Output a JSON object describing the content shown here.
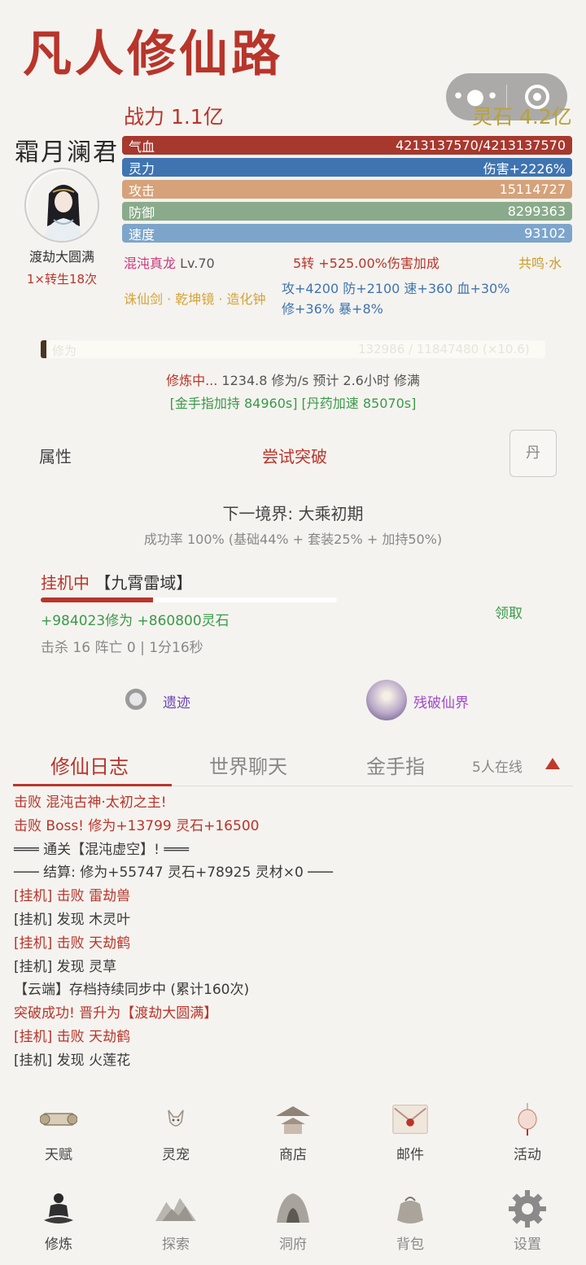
{
  "title": "凡人修仙路",
  "header": {
    "power": "战力 1.1亿",
    "spirit_stones": "灵石 4.2亿"
  },
  "player": {
    "name": "霜月澜君",
    "realm": "渡劫大圆满",
    "rebirth": "1×转生18次"
  },
  "stats": {
    "hp_label": "气血",
    "hp_value": "4213137570/4213137570",
    "mp_label": "灵力",
    "mp_value": "伤害+2226%",
    "atk_label": "攻击",
    "atk_value": "15114727",
    "def_label": "防御",
    "def_value": "8299363",
    "spd_label": "速度",
    "spd_value": "93102"
  },
  "pet": {
    "name": "混沌真龙",
    "level": "Lv.70",
    "rebirth_bonus": "5转 +525.00%伤害加成",
    "resonance": "共鸣·水"
  },
  "equipment": {
    "set": "诛仙剑 · 乾坤镜 · 造化钟",
    "bonus_line1": "攻+4200 防+2100 速+360 血+30%",
    "bonus_line2": "修+36% 暴+8%"
  },
  "cultivation": {
    "bar_label": "修为",
    "bar_value": "132986 / 11847480 (×10.6)",
    "progress": 0.011,
    "status": "修炼中...",
    "rate": " 1234.8 修为/s  预计 2.6小时 修满",
    "buffs": "[金手指加持 84960s] [丹药加速 85070s]"
  },
  "actions": {
    "attributes": "属性",
    "breakthrough": "尝试突破",
    "pill": "丹"
  },
  "breakthrough": {
    "next_realm": "下一境界: 大乘初期",
    "success_rate": "成功率 100% (基础44% + 套装25% + 加持50%)"
  },
  "afk": {
    "status": "挂机中",
    "location": " 【九霄雷域】",
    "progress": 0.38,
    "gains": "+984023修为  +860800灵石",
    "claim": "领取",
    "stats": "击杀 16  阵亡 0  |  1分16秒"
  },
  "portals": {
    "ruins": "遗迹",
    "broken_realm": "残破仙界"
  },
  "tabs": {
    "log": "修仙日志",
    "chat": "世界聊天",
    "cheat": "金手指",
    "online": "5人在线"
  },
  "log": [
    {
      "text": "击败 混沌古神·太初之主!",
      "color": "red"
    },
    {
      "text": "击败 Boss! 修为+13799 灵石+16500",
      "color": "red"
    },
    {
      "text": "═══ 通关【混沌虚空】! ═══",
      "color": "dark"
    },
    {
      "text": "─── 结算: 修为+55747 灵石+78925 灵材×0 ───",
      "color": "dark"
    },
    {
      "text": "[挂机] 击败 雷劫兽",
      "color": "red"
    },
    {
      "text": "[挂机] 发现 木灵叶",
      "color": "dark"
    },
    {
      "text": "[挂机] 击败 天劫鹤",
      "color": "red"
    },
    {
      "text": "[挂机] 发现 灵草",
      "color": "dark"
    },
    {
      "text": "【云端】存档持续同步中 (累计160次)",
      "color": "dark"
    },
    {
      "text": "突破成功! 晋升为【渡劫大圆满】",
      "color": "red"
    },
    {
      "text": "[挂机] 击败 天劫鹤",
      "color": "red"
    },
    {
      "text": "[挂机] 发现 火莲花",
      "color": "dark"
    }
  ],
  "nav_row1": [
    {
      "label": "天赋",
      "icon": "scroll-icon"
    },
    {
      "label": "灵宠",
      "icon": "fox-icon"
    },
    {
      "label": "商店",
      "icon": "pavilion-icon"
    },
    {
      "label": "邮件",
      "icon": "envelope-icon"
    },
    {
      "label": "活动",
      "icon": "lantern-icon"
    }
  ],
  "nav_row2": [
    {
      "label": "修炼",
      "icon": "meditate-icon"
    },
    {
      "label": "探索",
      "icon": "mountain-icon"
    },
    {
      "label": "洞府",
      "icon": "cave-icon"
    },
    {
      "label": "背包",
      "icon": "bag-icon"
    },
    {
      "label": "设置",
      "icon": "gear-icon"
    }
  ]
}
